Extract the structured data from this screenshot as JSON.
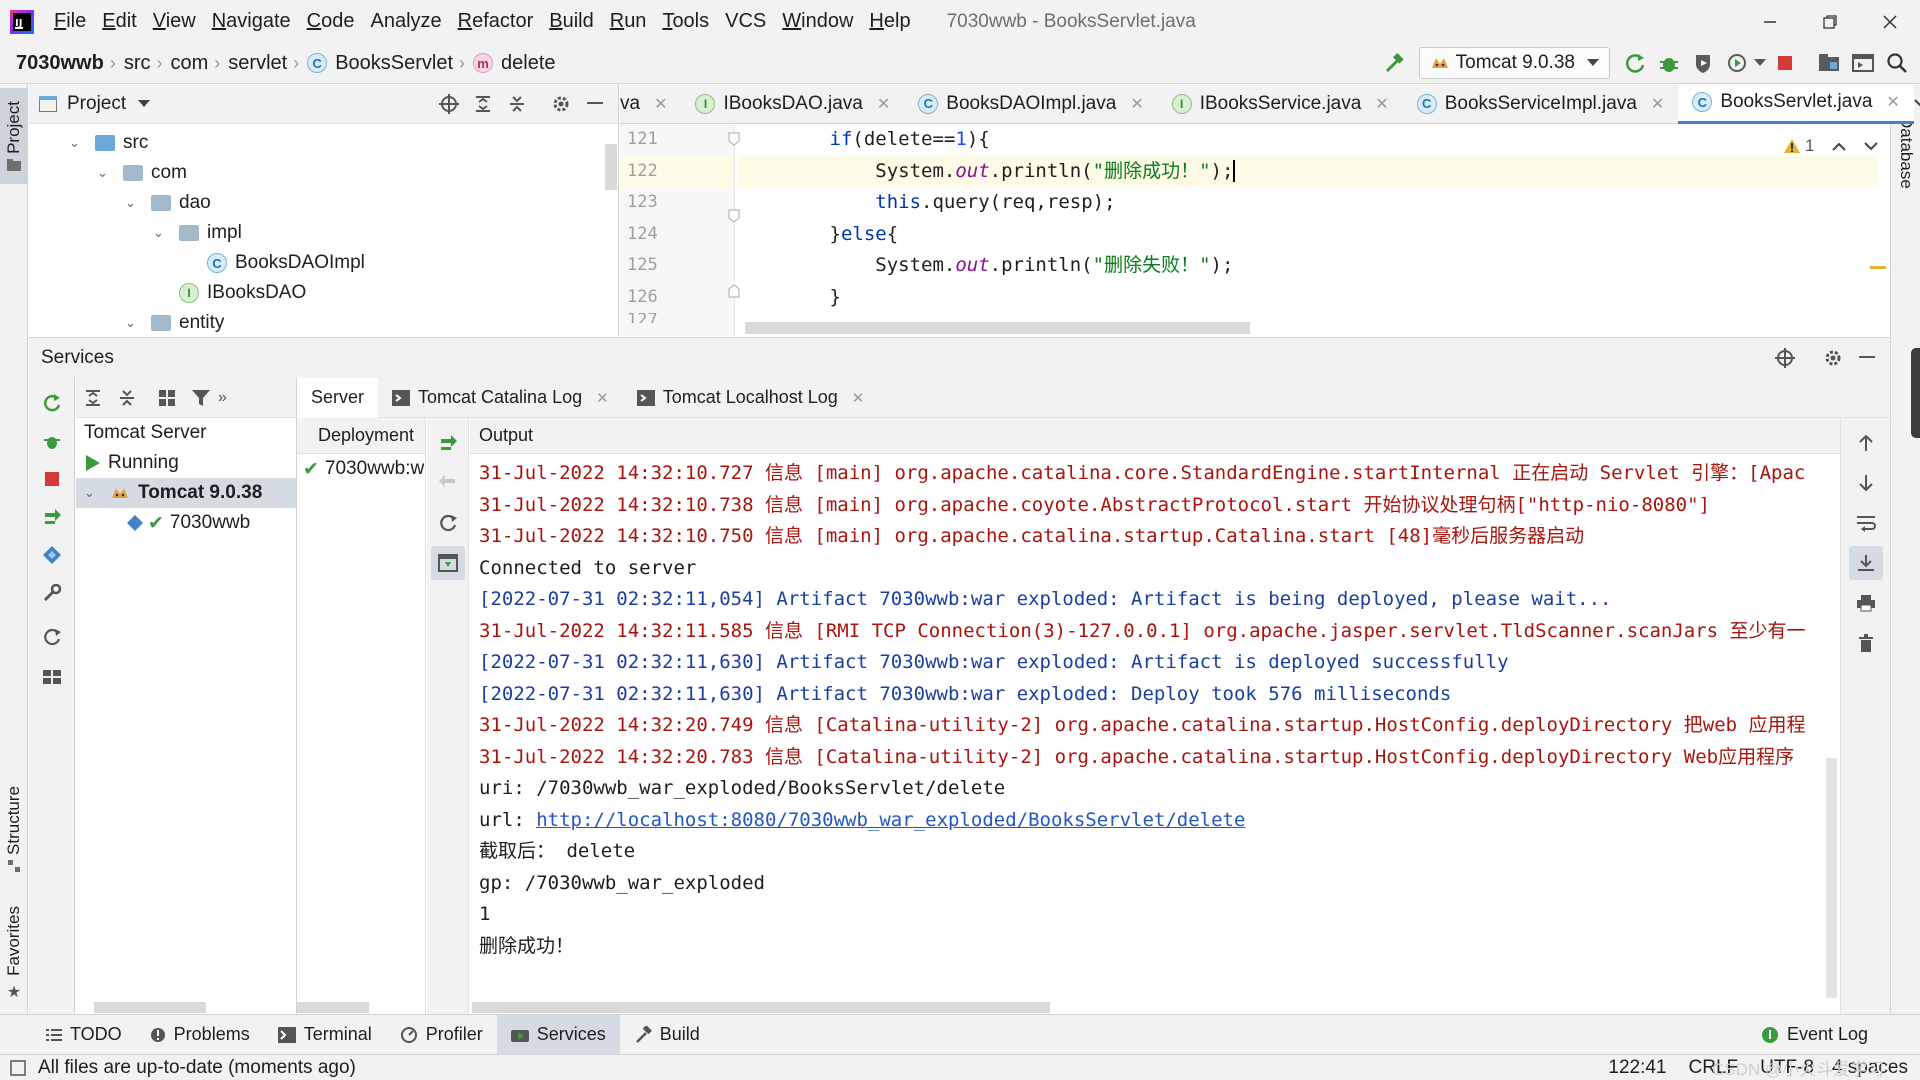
{
  "app": {
    "window_title": "7030wwb - BooksServlet.java",
    "menu": [
      {
        "label": "File",
        "u": "F",
        "rest": "ile"
      },
      {
        "label": "Edit",
        "u": "E",
        "rest": "dit"
      },
      {
        "label": "View",
        "u": "V",
        "rest": "iew"
      },
      {
        "label": "Navigate",
        "u": "N",
        "rest": "avigate"
      },
      {
        "label": "Code",
        "u": "C",
        "rest": "ode"
      },
      {
        "label": "Analyze",
        "u": "",
        "rest": "Analyze"
      },
      {
        "label": "Refactor",
        "u": "R",
        "rest": "efactor"
      },
      {
        "label": "Build",
        "u": "B",
        "rest": "uild"
      },
      {
        "label": "Run",
        "u": "R",
        "rest": "un"
      },
      {
        "label": "Tools",
        "u": "T",
        "rest": "ools"
      },
      {
        "label": "VCS",
        "u": "",
        "rest": "VCS"
      },
      {
        "label": "Window",
        "u": "W",
        "rest": "indow"
      },
      {
        "label": "Help",
        "u": "H",
        "rest": "elp"
      }
    ]
  },
  "nav": {
    "project": "7030wwb",
    "src": "src",
    "com": "com",
    "servlet": "servlet",
    "class": "BooksServlet",
    "method": "delete",
    "class_badge": "C",
    "method_badge": "m",
    "run_config": "Tomcat 9.0.38"
  },
  "project_pane": {
    "title": "Project",
    "items": [
      {
        "label": "src"
      },
      {
        "label": "com"
      },
      {
        "label": "dao"
      },
      {
        "label": "impl"
      },
      {
        "label": "BooksDAOImpl",
        "badge": "C"
      },
      {
        "label": "IBooksDAO",
        "badge": "I"
      },
      {
        "label": "entity"
      }
    ]
  },
  "editor": {
    "tabs": [
      {
        "label": "va",
        "badge": ""
      },
      {
        "label": "IBooksDAO.java",
        "badge": "I"
      },
      {
        "label": "BooksDAOImpl.java",
        "badge": "C"
      },
      {
        "label": "IBooksService.java",
        "badge": "I"
      },
      {
        "label": "BooksServiceImpl.java",
        "badge": "C"
      },
      {
        "label": "BooksServlet.java",
        "badge": "C"
      }
    ],
    "warning_count": "1",
    "line_numbers": [
      "121",
      "122",
      "123",
      "124",
      "125",
      "126",
      "127"
    ]
  },
  "services": {
    "title": "Services",
    "tree": [
      {
        "label": "Tomcat Server"
      },
      {
        "label": "Running"
      },
      {
        "label": "Tomcat 9.0.38"
      },
      {
        "label": "7030wwb"
      }
    ],
    "tabs": [
      {
        "label": "Server"
      },
      {
        "label": "Tomcat Catalina Log"
      },
      {
        "label": "Tomcat Localhost Log"
      }
    ],
    "deployment_header": "Deployment",
    "deployment_item": "7030wwb:w",
    "output_header": "Output",
    "output_lines": [
      {
        "text": "31-Jul-2022 14:32:10.727 信息 [main] org.apache.catalina.core.StandardEngine.startInternal 正在启动 Servlet 引擎：[Apac",
        "color": "red"
      },
      {
        "text": "31-Jul-2022 14:32:10.738 信息 [main] org.apache.coyote.AbstractProtocol.start 开始协议处理句柄[\"http-nio-8080\"]",
        "color": "red"
      },
      {
        "text": "31-Jul-2022 14:32:10.750 信息 [main] org.apache.catalina.startup.Catalina.start [48]毫秒后服务器启动",
        "color": "red"
      },
      {
        "text": "Connected to server",
        "color": "black"
      },
      {
        "text": "[2022-07-31 02:32:11,054] Artifact 7030wwb:war exploded: Artifact is being deployed, please wait...",
        "color": "blue"
      },
      {
        "text": "31-Jul-2022 14:32:11.585 信息 [RMI TCP Connection(3)-127.0.0.1] org.apache.jasper.servlet.TldScanner.scanJars 至少有一",
        "color": "red"
      },
      {
        "text": "[2022-07-31 02:32:11,630] Artifact 7030wwb:war exploded: Artifact is deployed successfully",
        "color": "blue"
      },
      {
        "text": "[2022-07-31 02:32:11,630] Artifact 7030wwb:war exploded: Deploy took 576 milliseconds",
        "color": "blue"
      },
      {
        "text": "31-Jul-2022 14:32:20.749 信息 [Catalina-utility-2] org.apache.catalina.startup.HostConfig.deployDirectory 把web 应用程",
        "color": "red"
      },
      {
        "text": "31-Jul-2022 14:32:20.783 信息 [Catalina-utility-2] org.apache.catalina.startup.HostConfig.deployDirectory Web应用程序",
        "color": "red"
      },
      {
        "text": "uri: /7030wwb_war_exploded/BooksServlet/delete",
        "color": "black"
      },
      {
        "text": "截取后： delete",
        "color": "black"
      },
      {
        "text": "gp: /7030wwb_war_exploded",
        "color": "black"
      },
      {
        "text": "1",
        "color": "black"
      },
      {
        "text": "删除成功！",
        "color": "black"
      }
    ],
    "url_prefix": "url: ",
    "url": "http://localhost:8080/7030wwb_war_exploded/BooksServlet/delete"
  },
  "bottom_tools": [
    {
      "label": "TODO"
    },
    {
      "label": "Problems"
    },
    {
      "label": "Terminal"
    },
    {
      "label": "Profiler"
    },
    {
      "label": "Services"
    },
    {
      "label": "Build"
    }
  ],
  "event_log": "Event Log",
  "status": {
    "message": "All files are up-to-date (moments ago)",
    "position": "122:41",
    "line_sep": "CRLF",
    "encoding": "UTF-8",
    "indent": "4 spaces",
    "watermark": "CSDN @小火斗爱学习"
  },
  "side_labels": {
    "project": "Project",
    "structure": "Structure",
    "favorites": "Favorites",
    "database": "Database"
  },
  "colors": {
    "accent": "#4083c9",
    "log_red": "#a8140e",
    "log_blue": "#1b3fa1",
    "run_green": "#3c9a3c",
    "stop_red": "#d33a3a"
  }
}
